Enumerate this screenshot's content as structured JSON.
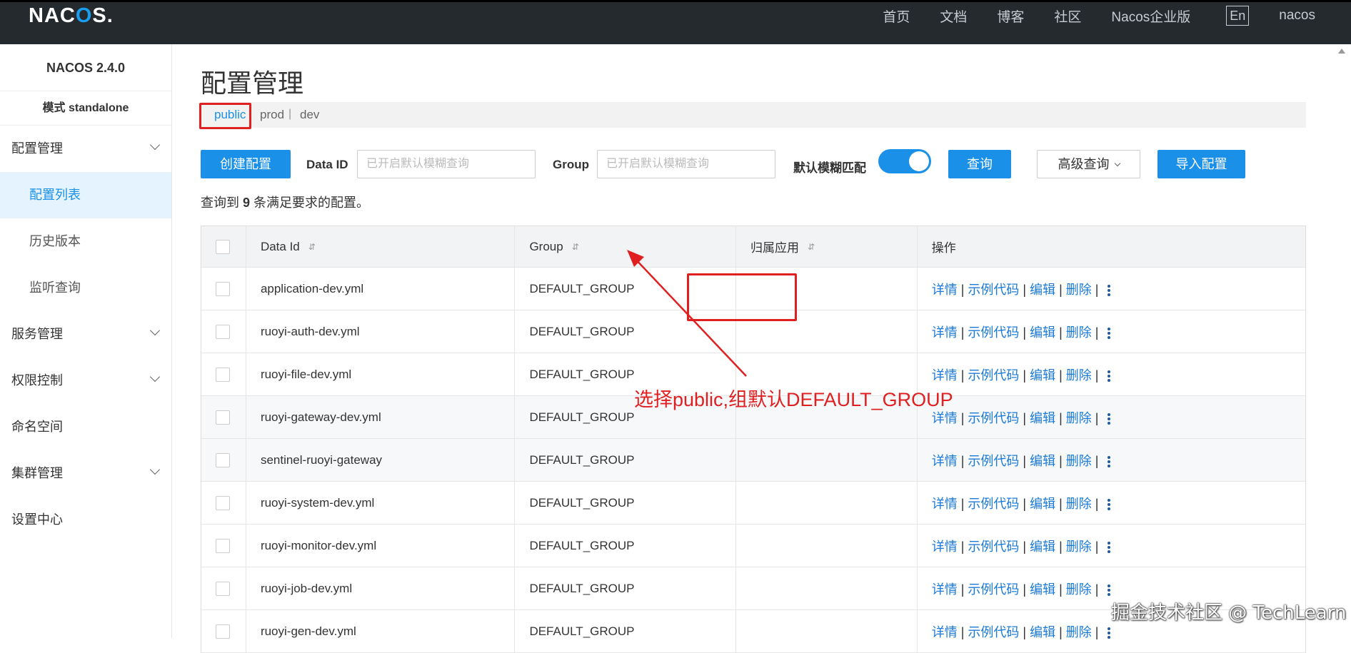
{
  "topnav": {
    "logo_main": "NAC",
    "logo_o": "O",
    "logo_end": "S.",
    "links": [
      "首页",
      "文档",
      "博客",
      "社区",
      "Nacos企业版"
    ],
    "lang": "En",
    "user": "nacos"
  },
  "sidebar": {
    "version": "NACOS 2.4.0",
    "mode": "模式 standalone",
    "menu": [
      {
        "label": "配置管理",
        "expandable": true
      },
      {
        "label": "配置列表",
        "sub": true,
        "active": true
      },
      {
        "label": "历史版本",
        "sub": true
      },
      {
        "label": "监听查询",
        "sub": true
      },
      {
        "label": "服务管理",
        "expandable": true
      },
      {
        "label": "权限控制",
        "expandable": true
      },
      {
        "label": "命名空间",
        "expandable": false
      },
      {
        "label": "集群管理",
        "expandable": true
      },
      {
        "label": "设置中心",
        "expandable": false
      }
    ]
  },
  "main": {
    "title": "配置管理",
    "namespaces": [
      "public",
      "prod",
      "dev"
    ],
    "ns_sep": "|",
    "toolbar": {
      "create_btn": "创建配置",
      "data_id_label": "Data ID",
      "data_id_placeholder": "已开启默认模糊查询",
      "group_label": "Group",
      "group_placeholder": "已开启默认模糊查询",
      "fuzzy_label": "默认模糊匹配",
      "query_btn": "查询",
      "advanced_btn": "高级查询",
      "import_btn": "导入配置"
    },
    "result": {
      "prefix": "查询到",
      "count": "9",
      "suffix": "条满足要求的配置。"
    },
    "table": {
      "headers": [
        "Data Id",
        "Group",
        "归属应用",
        "操作"
      ],
      "rows": [
        {
          "data_id": "application-dev.yml",
          "group": "DEFAULT_GROUP"
        },
        {
          "data_id": "ruoyi-auth-dev.yml",
          "group": "DEFAULT_GROUP"
        },
        {
          "data_id": "ruoyi-file-dev.yml",
          "group": "DEFAULT_GROUP"
        },
        {
          "data_id": "ruoyi-gateway-dev.yml",
          "group": "DEFAULT_GROUP"
        },
        {
          "data_id": "sentinel-ruoyi-gateway",
          "group": "DEFAULT_GROUP"
        },
        {
          "data_id": "ruoyi-system-dev.yml",
          "group": "DEFAULT_GROUP"
        },
        {
          "data_id": "ruoyi-monitor-dev.yml",
          "group": "DEFAULT_GROUP"
        },
        {
          "data_id": "ruoyi-job-dev.yml",
          "group": "DEFAULT_GROUP"
        },
        {
          "data_id": "ruoyi-gen-dev.yml",
          "group": "DEFAULT_GROUP"
        }
      ],
      "ops": [
        "详情",
        "示例代码",
        "编辑",
        "删除"
      ],
      "op_sep": "|"
    },
    "annotation": "选择public,组默认DEFAULT_GROUP",
    "watermark": "掘金技术社区 @ TechLearn"
  },
  "colors": {
    "accent": "#1a90e8",
    "annotation": "#e02020",
    "topbar": "#252a2f"
  },
  "icons": [
    "chevron-down-icon",
    "sort-icon",
    "more-icon",
    "annotation-arrow"
  ]
}
